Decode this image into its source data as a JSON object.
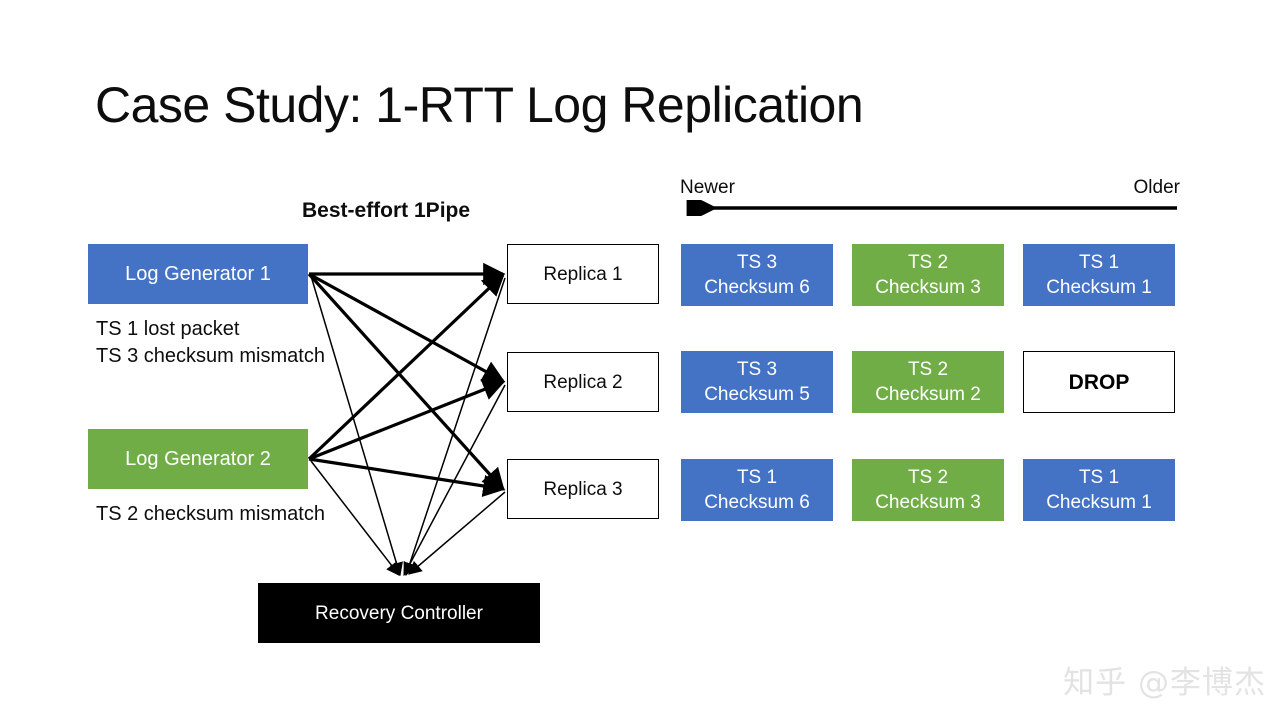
{
  "slide": {
    "title": "Case Study: 1-RTT Log Replication",
    "watermark": "知乎 @李博杰"
  },
  "pipeline": {
    "label": "Best-effort 1Pipe"
  },
  "time_axis": {
    "left_label": "Newer",
    "right_label": "Older"
  },
  "generators": [
    {
      "label": "Log Generator 1",
      "color": "#4472C4",
      "note": "TS 1 lost packet\nTS 3 checksum mismatch"
    },
    {
      "label": "Log Generator 2",
      "color": "#70AD47",
      "note": "TS 2 checksum mismatch"
    }
  ],
  "replicas": [
    {
      "label": "Replica 1"
    },
    {
      "label": "Replica 2"
    },
    {
      "label": "Replica 3"
    }
  ],
  "controller": {
    "label": "Recovery Controller",
    "color": "#000000"
  },
  "log_rows": [
    {
      "replica": "Replica 1",
      "cells": [
        {
          "ts": "TS 3",
          "checksum": "Checksum 6",
          "state": "ok",
          "color": "#4472C4"
        },
        {
          "ts": "TS 2",
          "checksum": "Checksum 3",
          "state": "ok",
          "color": "#70AD47"
        },
        {
          "ts": "TS 1",
          "checksum": "Checksum 1",
          "state": "ok",
          "color": "#4472C4"
        }
      ]
    },
    {
      "replica": "Replica 2",
      "cells": [
        {
          "ts": "TS 3",
          "checksum": "Checksum 5",
          "state": "ok",
          "color": "#4472C4"
        },
        {
          "ts": "TS 2",
          "checksum": "Checksum 2",
          "state": "ok",
          "color": "#70AD47"
        },
        {
          "ts": "DROP",
          "checksum": "",
          "state": "drop",
          "color": "#FFFFFF"
        }
      ]
    },
    {
      "replica": "Replica 3",
      "cells": [
        {
          "ts": "TS 1",
          "checksum": "Checksum 6",
          "state": "ok",
          "color": "#4472C4"
        },
        {
          "ts": "TS 2",
          "checksum": "Checksum 3",
          "state": "ok",
          "color": "#70AD47"
        },
        {
          "ts": "TS 1",
          "checksum": "Checksum 1",
          "state": "ok",
          "color": "#4472C4"
        }
      ]
    }
  ]
}
